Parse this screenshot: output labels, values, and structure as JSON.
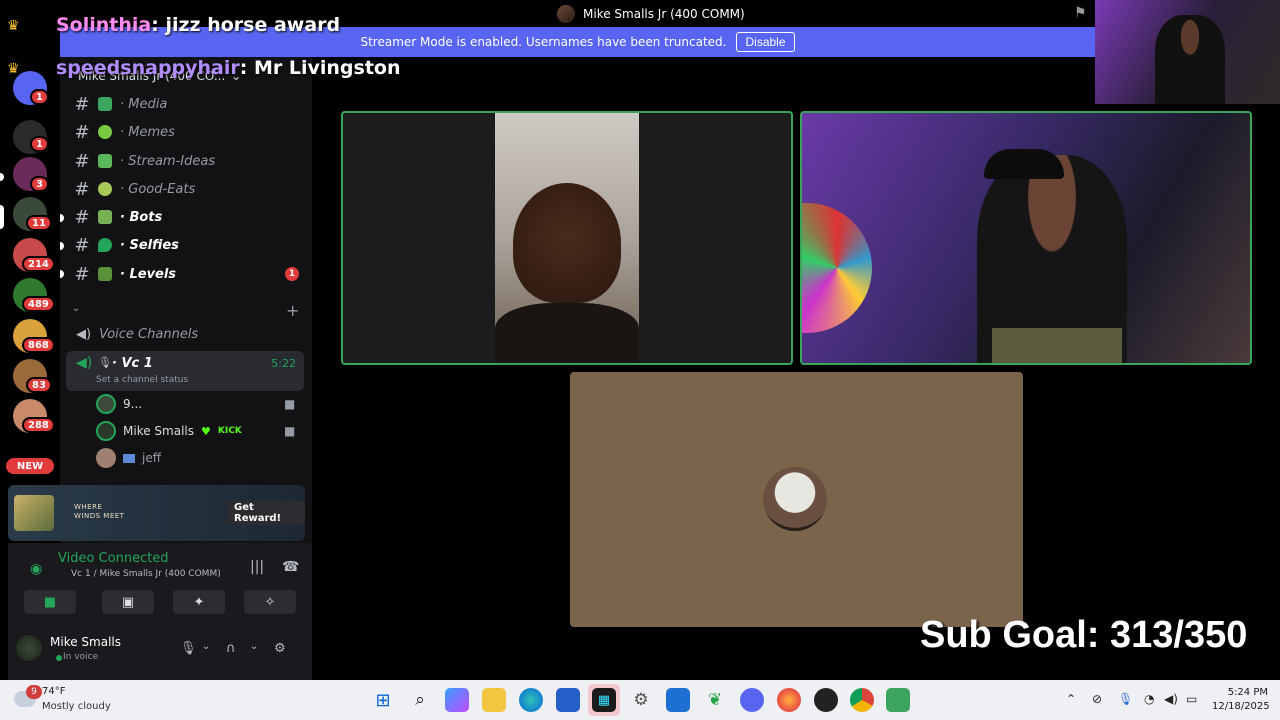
{
  "window": {
    "title": "Mike Smalls Jr (400 COMM)"
  },
  "banner": {
    "text": "Streamer Mode is enabled. Usernames have been truncated.",
    "button": "Disable"
  },
  "chat": [
    {
      "user": "Solinthia",
      "message": "jizz horse award"
    },
    {
      "user": "speedsnappyhair",
      "message": "Mr Livingston"
    }
  ],
  "rail": {
    "badges": [
      "1",
      "1",
      "3",
      "11",
      "214",
      "489",
      "868",
      "83",
      "288"
    ],
    "new_label": "NEW"
  },
  "server": {
    "name": "Mike Smalls Jr (400 CO..."
  },
  "channels": [
    {
      "name": "· Media",
      "icon": "tv-icon",
      "color": "#3ba55d",
      "bold": false
    },
    {
      "name": "· Memes",
      "icon": "green-apple-icon",
      "color": "#7ac943",
      "bold": false
    },
    {
      "name": "· Stream-Ideas",
      "icon": "notebook-icon",
      "color": "#5db85b",
      "bold": false
    },
    {
      "name": "· Good-Eats",
      "icon": "melon-icon",
      "color": "#a7c957",
      "bold": false
    },
    {
      "name": "· Bots",
      "icon": "puzzle-icon",
      "color": "#77b255",
      "bold": true
    },
    {
      "name": "· Selfies",
      "icon": "green-heart-icon",
      "color": "#23a55a",
      "bold": true
    },
    {
      "name": "· Levels",
      "icon": "chart-icon",
      "color": "#5c913b",
      "bold": true,
      "mention": "1"
    }
  ],
  "voice": {
    "header": "Voice Channels",
    "channel": "· Vc 1",
    "timer": "5:22",
    "status": "Set a channel status",
    "members": [
      {
        "name": "9...",
        "tag": ""
      },
      {
        "name": "Mike Smalls",
        "tag": "KICK"
      },
      {
        "name": "jeff",
        "tag": ""
      }
    ]
  },
  "reward": {
    "logo_line1": "WHERE",
    "logo_line2": "WINDS MEET",
    "button": "Get Reward!"
  },
  "connection": {
    "status": "Video Connected",
    "location": "Vc 1 / Mike Smalls Jr (400 COMM)"
  },
  "user": {
    "name": "Mike Smalls",
    "status": "In voice"
  },
  "overlay": {
    "sub_goal": "Sub Goal: 313/350"
  },
  "taskbar": {
    "weather_badge": "9",
    "temperature": "74°F",
    "condition": "Mostly cloudy",
    "time": "5:24 PM",
    "date": "12/18/2025"
  },
  "colors": {
    "accent": "#5865f2",
    "voice_green": "#23a55a",
    "taskbar": "#eef0f4"
  }
}
